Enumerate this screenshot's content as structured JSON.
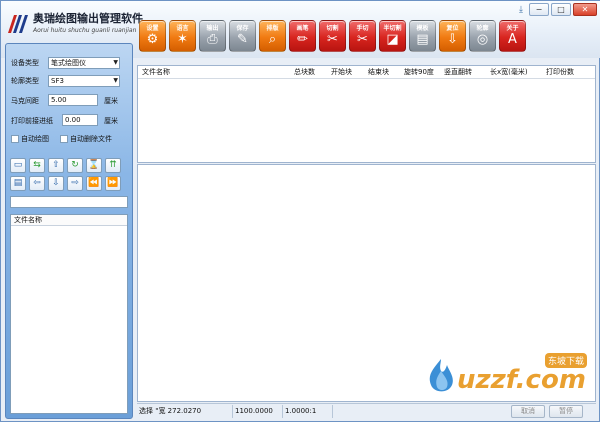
{
  "app": {
    "title": "奥瑞绘图输出管理软件",
    "subtitle": "Aorui huitu shuchu guanli ruanjian"
  },
  "toolbar": [
    {
      "label": "设置",
      "glyph": "⚙",
      "style": "orange",
      "icon": "settings-icon"
    },
    {
      "label": "语言",
      "glyph": "✶",
      "style": "orange",
      "icon": "language-icon"
    },
    {
      "label": "输出",
      "glyph": "⎙",
      "style": "grey",
      "icon": "print-icon"
    },
    {
      "label": "保存",
      "glyph": "✎",
      "style": "grey",
      "icon": "save-icon"
    },
    {
      "label": "排版",
      "glyph": "⌕",
      "style": "orange",
      "icon": "layout-icon"
    },
    {
      "label": "画笔",
      "glyph": "✏",
      "style": "red",
      "icon": "pen-icon"
    },
    {
      "label": "切割",
      "glyph": "✂",
      "style": "red",
      "icon": "cut-icon"
    },
    {
      "label": "手切",
      "glyph": "✂",
      "style": "red",
      "icon": "manual-cut-icon"
    },
    {
      "label": "半切割",
      "glyph": "◪",
      "style": "red",
      "icon": "half-cut-icon"
    },
    {
      "label": "模板",
      "glyph": "▤",
      "style": "grey",
      "icon": "template-icon"
    },
    {
      "label": "复位",
      "glyph": "⇩",
      "style": "orange",
      "icon": "reset-icon"
    },
    {
      "label": "轮廓",
      "glyph": "◎",
      "style": "grey",
      "icon": "outline-icon"
    },
    {
      "label": "关于",
      "glyph": "A",
      "style": "red",
      "icon": "about-icon"
    }
  ],
  "settings": {
    "device_type_label": "设备类型",
    "device_type_value": "笔式绘图仪",
    "outline_type_label": "轮廓类型",
    "outline_type_value": "SF3",
    "mark_distance_label": "马克间距",
    "mark_distance_value": "5.00",
    "mark_distance_unit": "厘米",
    "paper_feed_label": "打印前接进纸",
    "paper_feed_value": "0.00",
    "paper_feed_unit": "厘米",
    "auto_plot_label": "自动绘图",
    "auto_delete_label": "自动删除文件"
  },
  "icon_buttons": [
    {
      "glyph": "▭",
      "icon": "folder-icon",
      "green": false
    },
    {
      "glyph": "⇆",
      "icon": "swap-icon",
      "green": true
    },
    {
      "glyph": "⇧",
      "icon": "arrow-up-icon",
      "green": false
    },
    {
      "glyph": "↻",
      "icon": "refresh-icon",
      "green": true
    },
    {
      "glyph": "⌛",
      "icon": "hourglass-icon",
      "green": true
    },
    {
      "glyph": "⇈",
      "icon": "top-icon",
      "green": true
    },
    {
      "glyph": "▤",
      "icon": "document-icon",
      "green": false
    },
    {
      "glyph": "⇦",
      "icon": "arrow-left-icon",
      "green": false
    },
    {
      "glyph": "⇩",
      "icon": "arrow-down-icon",
      "green": false
    },
    {
      "glyph": "⇨",
      "icon": "arrow-right-icon",
      "green": false
    },
    {
      "glyph": "⏪",
      "icon": "rewind-icon",
      "green": false
    },
    {
      "glyph": "⏩",
      "icon": "fast-forward-icon",
      "green": false
    }
  ],
  "file_list": {
    "header": "文件名称"
  },
  "table": {
    "columns": [
      "文件名称",
      "总块数",
      "开始块",
      "结束块",
      "旋转90度",
      "竖直翻转",
      "长x宽(毫米)",
      "打印份数"
    ]
  },
  "status": {
    "selection": "选择 \"宽 272.0270",
    "value2": "1100.0000",
    "value3": "1.0000:1",
    "cancel_label": "取消",
    "pause_label": "暂停"
  },
  "watermark": {
    "brand": "uzzf.com",
    "sub": "东坡下载"
  }
}
